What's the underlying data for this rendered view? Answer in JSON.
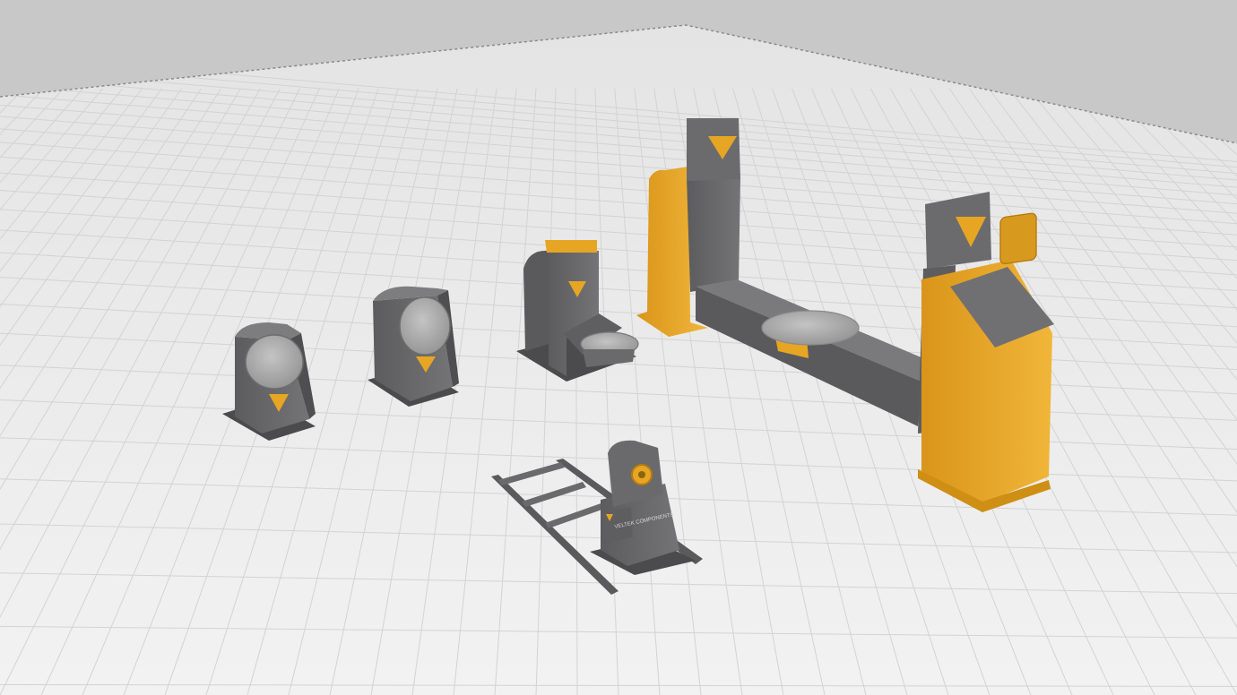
{
  "scene": {
    "background_color": "#c8c8c8",
    "floor_color": "#ececec",
    "grid_line_color": "#d3d3d3",
    "grid_line_dark": "#bdbdbd",
    "machine_body_color": "#6b6b6d",
    "machine_accent_color": "#e6a623",
    "plate_color": "#a8a8a8"
  },
  "brand": {
    "logo_icon": "v-logo-icon",
    "tailstock_plate_text": "VELTEK COMPONENTS"
  },
  "objects": [
    {
      "id": "tilt-positioner-small",
      "icon": "positioner-icon"
    },
    {
      "id": "tilt-positioner-medium",
      "icon": "positioner-icon"
    },
    {
      "id": "l-type-positioner",
      "icon": "positioner-icon"
    },
    {
      "id": "two-axis-headstock-tailstock",
      "icon": "positioner-icon"
    },
    {
      "id": "headstock-on-rail",
      "icon": "rail-icon"
    }
  ]
}
